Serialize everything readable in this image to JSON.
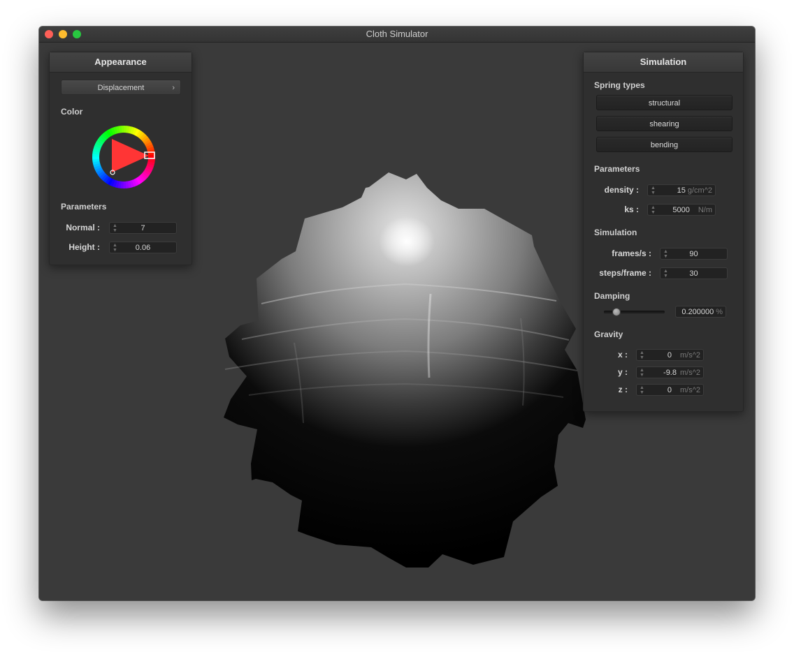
{
  "window": {
    "title": "Cloth Simulator"
  },
  "appearance": {
    "title": "Appearance",
    "shader_dropdown": "Displacement",
    "color_label": "Color",
    "color_hex": "#ff0000",
    "parameters_label": "Parameters",
    "normal": {
      "label": "Normal :",
      "value": "7"
    },
    "height": {
      "label": "Height :",
      "value": "0.06"
    }
  },
  "simulation": {
    "title": "Simulation",
    "spring_types_label": "Spring types",
    "spring_buttons": [
      "structural",
      "shearing",
      "bending"
    ],
    "parameters_label": "Parameters",
    "density": {
      "label": "density :",
      "value": "15",
      "unit": "g/cm^2"
    },
    "ks": {
      "label": "ks :",
      "value": "5000",
      "unit": "N/m"
    },
    "simulation_label": "Simulation",
    "frames": {
      "label": "frames/s :",
      "value": "90"
    },
    "steps": {
      "label": "steps/frame :",
      "value": "30"
    },
    "damping_label": "Damping",
    "damping": {
      "value": "0.200000",
      "unit": "%",
      "slider_fraction": 0.2
    },
    "gravity_label": "Gravity",
    "gravity": {
      "x": {
        "label": "x :",
        "value": "0",
        "unit": "m/s^2"
      },
      "y": {
        "label": "y :",
        "value": "-9.8",
        "unit": "m/s^2"
      },
      "z": {
        "label": "z :",
        "value": "0",
        "unit": "m/s^2"
      }
    }
  }
}
